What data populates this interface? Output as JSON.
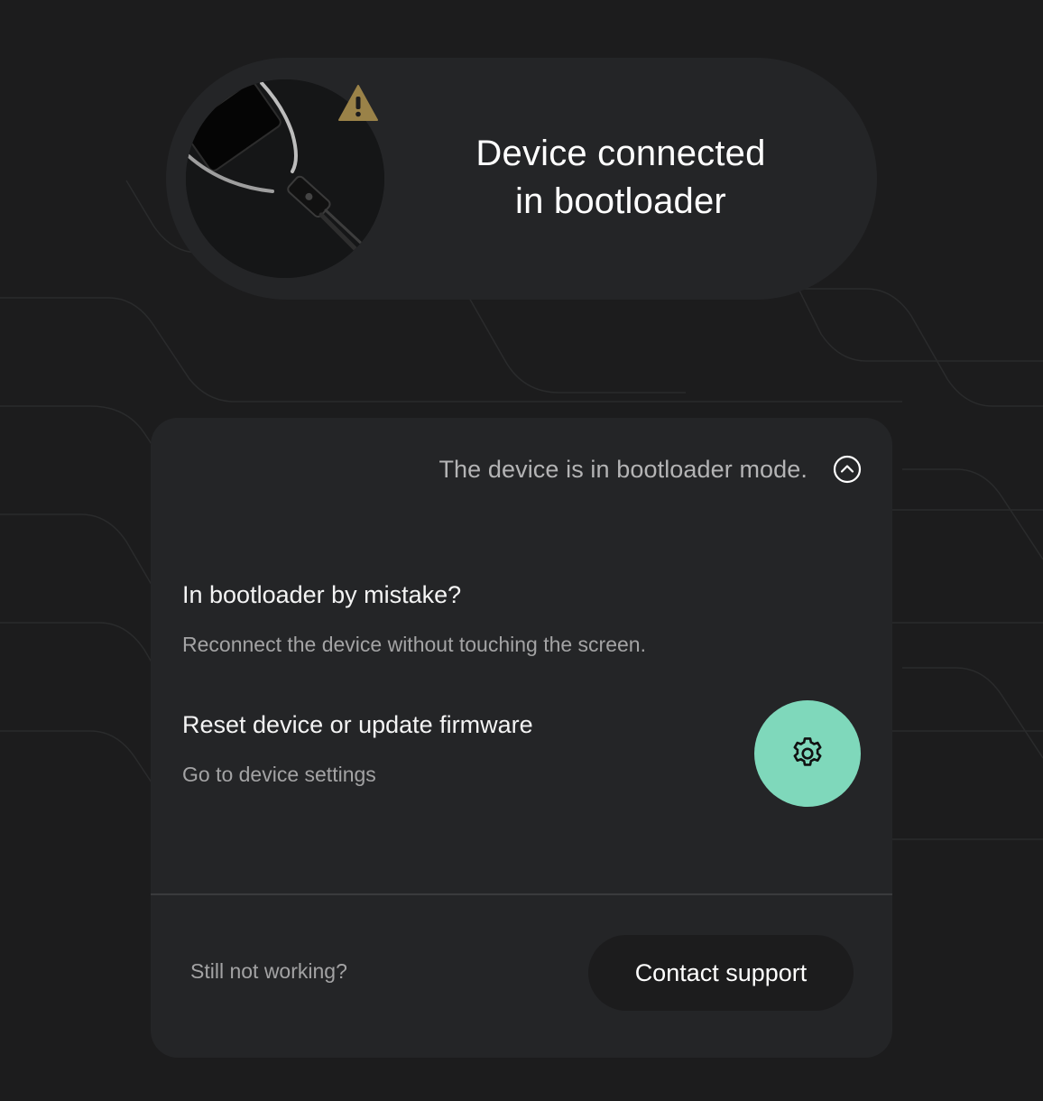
{
  "status": {
    "title": "Device connected\nin bootloader",
    "warning_color": "#9a8248"
  },
  "card": {
    "header_text": "The device is in bootloader mode.",
    "sections": [
      {
        "title": "In bootloader by mistake?",
        "description": "Reconnect the device without touching the screen."
      },
      {
        "title": "Reset device or update firmware",
        "description": "Go to device settings"
      }
    ],
    "settings_button_color": "#7fd8bb",
    "footer": {
      "prompt": "Still not working?",
      "contact_label": "Contact support"
    }
  },
  "icons": {
    "warning": "warning-icon",
    "collapse": "chevron-up-circle-icon",
    "settings": "gear-icon",
    "device": "device-illustration"
  }
}
